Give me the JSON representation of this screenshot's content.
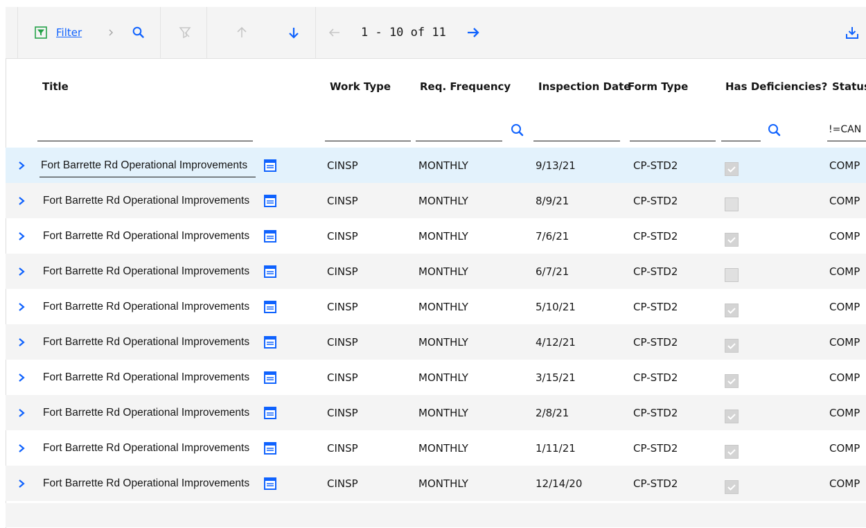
{
  "toolbar": {
    "filter_label": "Filter",
    "pager_text": "1 - 10 of 11"
  },
  "columns": {
    "title": "Title",
    "work_type": "Work Type",
    "req_frequency": "Req. Frequency",
    "inspection_date": "Inspection Date",
    "form_type": "Form Type",
    "has_deficiencies": "Has Deficiencies?",
    "status": "Status"
  },
  "filters": {
    "status_value": "!=CAN"
  },
  "rows": [
    {
      "title": "Fort Barrette Rd Operational Improvements",
      "work_type": "CINSP",
      "frequency": "MONTHLY",
      "date": "9/13/21",
      "form": "CP-STD2",
      "deficiencies": true,
      "status": "COMP",
      "selected": true
    },
    {
      "title": "Fort Barrette Rd Operational Improvements",
      "work_type": "CINSP",
      "frequency": "MONTHLY",
      "date": "8/9/21",
      "form": "CP-STD2",
      "deficiencies": false,
      "status": "COMP"
    },
    {
      "title": "Fort Barrette Rd Operational Improvements",
      "work_type": "CINSP",
      "frequency": "MONTHLY",
      "date": "7/6/21",
      "form": "CP-STD2",
      "deficiencies": true,
      "status": "COMP"
    },
    {
      "title": "Fort Barrette Rd Operational Improvements",
      "work_type": "CINSP",
      "frequency": "MONTHLY",
      "date": "6/7/21",
      "form": "CP-STD2",
      "deficiencies": false,
      "status": "COMP"
    },
    {
      "title": "Fort Barrette Rd Operational Improvements",
      "work_type": "CINSP",
      "frequency": "MONTHLY",
      "date": "5/10/21",
      "form": "CP-STD2",
      "deficiencies": true,
      "status": "COMP"
    },
    {
      "title": "Fort Barrette Rd Operational Improvements",
      "work_type": "CINSP",
      "frequency": "MONTHLY",
      "date": "4/12/21",
      "form": "CP-STD2",
      "deficiencies": true,
      "status": "COMP"
    },
    {
      "title": "Fort Barrette Rd Operational Improvements",
      "work_type": "CINSP",
      "frequency": "MONTHLY",
      "date": "3/15/21",
      "form": "CP-STD2",
      "deficiencies": true,
      "status": "COMP"
    },
    {
      "title": "Fort Barrette Rd Operational Improvements",
      "work_type": "CINSP",
      "frequency": "MONTHLY",
      "date": "2/8/21",
      "form": "CP-STD2",
      "deficiencies": true,
      "status": "COMP"
    },
    {
      "title": "Fort Barrette Rd Operational Improvements",
      "work_type": "CINSP",
      "frequency": "MONTHLY",
      "date": "1/11/21",
      "form": "CP-STD2",
      "deficiencies": true,
      "status": "COMP"
    },
    {
      "title": "Fort Barrette Rd Operational Improvements",
      "work_type": "CINSP",
      "frequency": "MONTHLY",
      "date": "12/14/20",
      "form": "CP-STD2",
      "deficiencies": true,
      "status": "COMP"
    }
  ],
  "colors": {
    "accent": "#0f62fe",
    "row_selected": "#e3f2fc",
    "row_alt": "#f4f4f4"
  },
  "icons": {
    "filter": "filter-icon",
    "search": "search-icon",
    "clear_filter": "clear-filter-icon",
    "sort_up": "arrow-up-icon",
    "sort_down": "arrow-down-icon",
    "prev_page": "arrow-left-icon",
    "next_page": "arrow-right-icon",
    "download": "download-icon",
    "expand": "chevron-right-icon",
    "details": "details-icon"
  }
}
